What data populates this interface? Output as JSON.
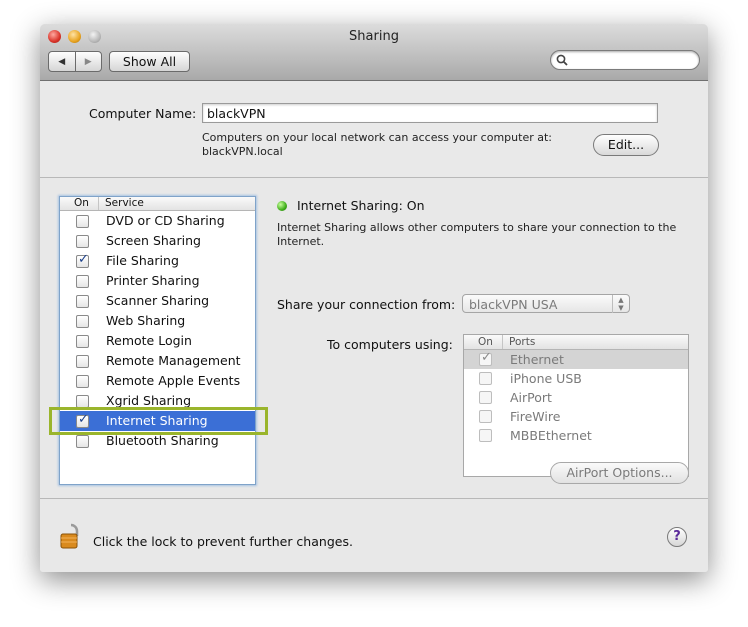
{
  "window": {
    "title": "Sharing",
    "show_all": "Show All",
    "search_placeholder": ""
  },
  "computer_name": {
    "label": "Computer Name:",
    "value": "blackVPN",
    "info_line1": "Computers on your local network can access your computer at:",
    "info_line2": "blackVPN.local",
    "edit_button": "Edit..."
  },
  "services": {
    "header_on": "On",
    "header_service": "Service",
    "items": [
      {
        "label": "DVD or CD Sharing",
        "checked": false
      },
      {
        "label": "Screen Sharing",
        "checked": false
      },
      {
        "label": "File Sharing",
        "checked": true
      },
      {
        "label": "Printer Sharing",
        "checked": false
      },
      {
        "label": "Scanner Sharing",
        "checked": false
      },
      {
        "label": "Web Sharing",
        "checked": false
      },
      {
        "label": "Remote Login",
        "checked": false
      },
      {
        "label": "Remote Management",
        "checked": false
      },
      {
        "label": "Remote Apple Events",
        "checked": false
      },
      {
        "label": "Xgrid Sharing",
        "checked": false
      },
      {
        "label": "Internet Sharing",
        "checked": true,
        "selected": true
      },
      {
        "label": "Bluetooth Sharing",
        "checked": false
      }
    ]
  },
  "detail": {
    "status": "Internet Sharing: On",
    "status_color": "#3fae1a",
    "description_line1": "Internet Sharing allows other computers to share your connection to the",
    "description_line2": "Internet.",
    "share_from_label": "Share your connection from:",
    "share_from_value": "blackVPN USA",
    "to_computers_label": "To computers using:",
    "ports_header_on": "On",
    "ports_header_ports": "Ports",
    "ports": [
      {
        "label": "Ethernet",
        "checked": true,
        "selected": true
      },
      {
        "label": "iPhone USB",
        "checked": false
      },
      {
        "label": "AirPort",
        "checked": false
      },
      {
        "label": "FireWire",
        "checked": false
      },
      {
        "label": "MBBEthernet",
        "checked": false
      }
    ],
    "airport_options": "AirPort Options..."
  },
  "footer": {
    "lock_text": "Click the lock to prevent further changes.",
    "help": "?"
  },
  "colors": {
    "selection": "#3b6fd6",
    "highlight_border": "#9ab52c"
  }
}
